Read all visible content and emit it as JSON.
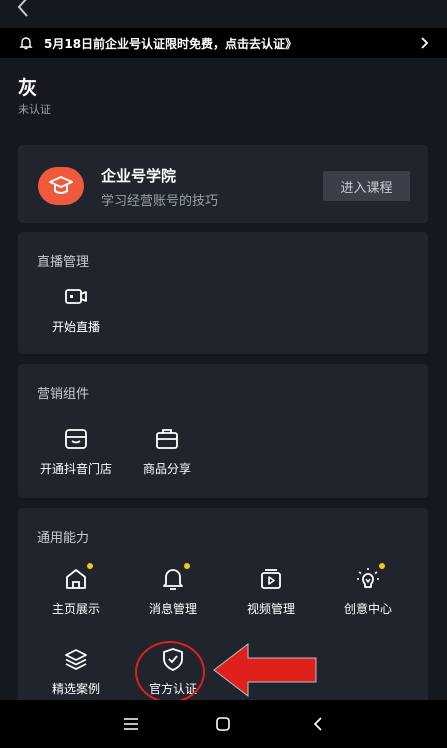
{
  "banner": {
    "text": "5月18日前企业号认证限时免费，点击去认证》"
  },
  "profile": {
    "name": "灰",
    "status": "未认证"
  },
  "academy": {
    "title": "企业号学院",
    "subtitle": "学习经营账号的技巧",
    "button": "进入课程"
  },
  "sections": {
    "live": {
      "title": "直播管理",
      "items": [
        {
          "label": "开始直播",
          "icon": "video-camera-icon"
        }
      ]
    },
    "marketing": {
      "title": "营销组件",
      "items": [
        {
          "label": "开通抖音门店",
          "icon": "storefront-icon"
        },
        {
          "label": "商品分享",
          "icon": "briefcase-icon"
        }
      ]
    },
    "general": {
      "title": "通用能力",
      "items": [
        {
          "label": "主页展示",
          "icon": "home-icon"
        },
        {
          "label": "消息管理",
          "icon": "bell-icon"
        },
        {
          "label": "视频管理",
          "icon": "video-play-icon"
        },
        {
          "label": "创意中心",
          "icon": "lightbulb-icon"
        },
        {
          "label": "精选案例",
          "icon": "layers-icon"
        },
        {
          "label": "官方认证",
          "icon": "shield-check-icon"
        }
      ]
    }
  },
  "colors": {
    "background": "#15181f",
    "card": "#20242d",
    "accent": "#f05a3c",
    "badge": "#f5c518",
    "annotation": "#e0201a"
  }
}
